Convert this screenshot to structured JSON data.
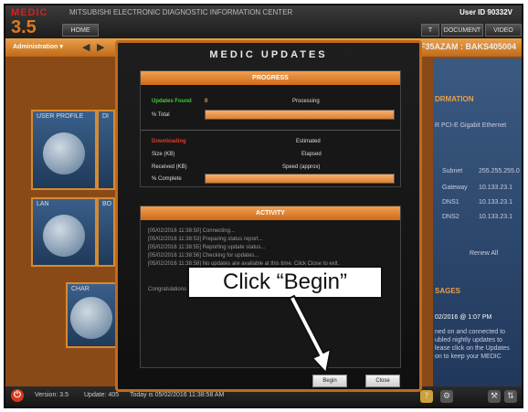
{
  "app": {
    "logo_top": "MEDIC",
    "logo_version": "3.5",
    "corp_name": "MITSUBISHI ELECTRONIC DIAGNOSTIC INFORMATION CENTER",
    "user_id_label": "User ID",
    "user_id": "90332V",
    "nav_tabs": [
      "HOME",
      "T",
      "DOCUMENT",
      "VIDEO"
    ],
    "admin_menu": "Administration ▾",
    "device_id": "DF35AZAM : BAKS405004"
  },
  "dashboard": {
    "tiles": [
      "USER PROFILE",
      "DI",
      "LAN",
      "BO",
      "CHAR"
    ],
    "right_panel_heading": "DRMATION",
    "right_panel_text": "R PCI-E Gigabit Ethernet",
    "net_rows": [
      {
        "label": "Subnet",
        "value": "255.255.255.0"
      },
      {
        "label": "Gateway",
        "value": "10.133.23.1"
      },
      {
        "label": "DNS1",
        "value": "10.133.23.1"
      },
      {
        "label": "DNS2",
        "value": "10.133.23.1"
      }
    ],
    "renew_label": "Renew All",
    "messages_heading": "SAGES",
    "message_date": "02/2016 @ 1:07 PM",
    "message_lines": [
      "ned on and connected to",
      "ubled nightly updates to",
      "lease click on the Updates",
      "on to keep your MEDIC"
    ]
  },
  "status_bar": {
    "version_label": "Version: 3.5",
    "update_label": "Update: 405",
    "today_label": "Today is 05/02/2016 11:38:58 AM"
  },
  "modal": {
    "title": "MEDIC UPDATES",
    "progress": {
      "heading": "PROGRESS",
      "updates_found_label": "Updates Found",
      "updates_found_value": "0",
      "status": "Processing",
      "total_label": "% Total",
      "total_percent": 100,
      "downloading_label": "Downloading",
      "estimated_label": "Estimated",
      "size_label": "Size (KB)",
      "elapsed_label": "Elapsed",
      "received_label": "Received (KB)",
      "speed_label": "Speed (approx)",
      "complete_label": "% Complete",
      "complete_percent": 100
    },
    "activity": {
      "heading": "ACTIVITY",
      "log_lines": [
        "[05/02/2016 11:38:50] Connecting...",
        "[05/02/2016 11:38:53] Preparing status report...",
        "[05/02/2016 11:38:55] Reporting update status...",
        "[05/02/2016 11:38:56] Checking for updates...",
        "[05/02/2016 11:38:58] No updates are available at this time. Click Close to exit."
      ],
      "congrats": "Congratulations"
    },
    "begin_label": "Begin",
    "close_label": "Close"
  },
  "annotation": {
    "callout": "Click “Begin”"
  }
}
